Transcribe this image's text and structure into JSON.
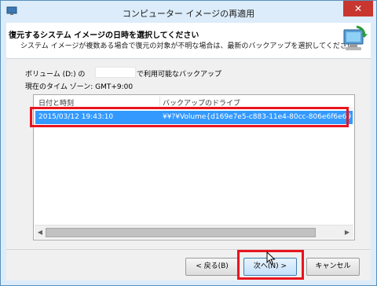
{
  "window": {
    "title": "コンピューター イメージの再適用",
    "close_label": "✕"
  },
  "header": {
    "title": "復元するシステム イメージの日時を選択してください",
    "description": "システム イメージが複数ある場合で復元の対象が不明な場合は、最新のバックアップを選択してください。"
  },
  "volume": {
    "label_prefix": "ボリューム (D:) の",
    "label_suffix": "で利用可能なバックアップ"
  },
  "timezone_text": "現在のタイム ゾーン: GMT+9:00",
  "table": {
    "columns": [
      "日付と時刻",
      "バックアップのドライブ"
    ],
    "rows": [
      {
        "date": "2015/03/12 19:43:10",
        "drive": "¥¥?¥Volume{d169e7e5-c883-11e4-80cc-806e6f6e6963}",
        "selected": true
      }
    ],
    "scroll_left": "◀",
    "scroll_right": "▶"
  },
  "buttons": {
    "back": "< 戻る(B)",
    "next": "次へ(N) >",
    "cancel": "キャンセル"
  },
  "colors": {
    "selection": "#3399ff",
    "highlight": "#e8141e",
    "close": "#c7372f"
  }
}
